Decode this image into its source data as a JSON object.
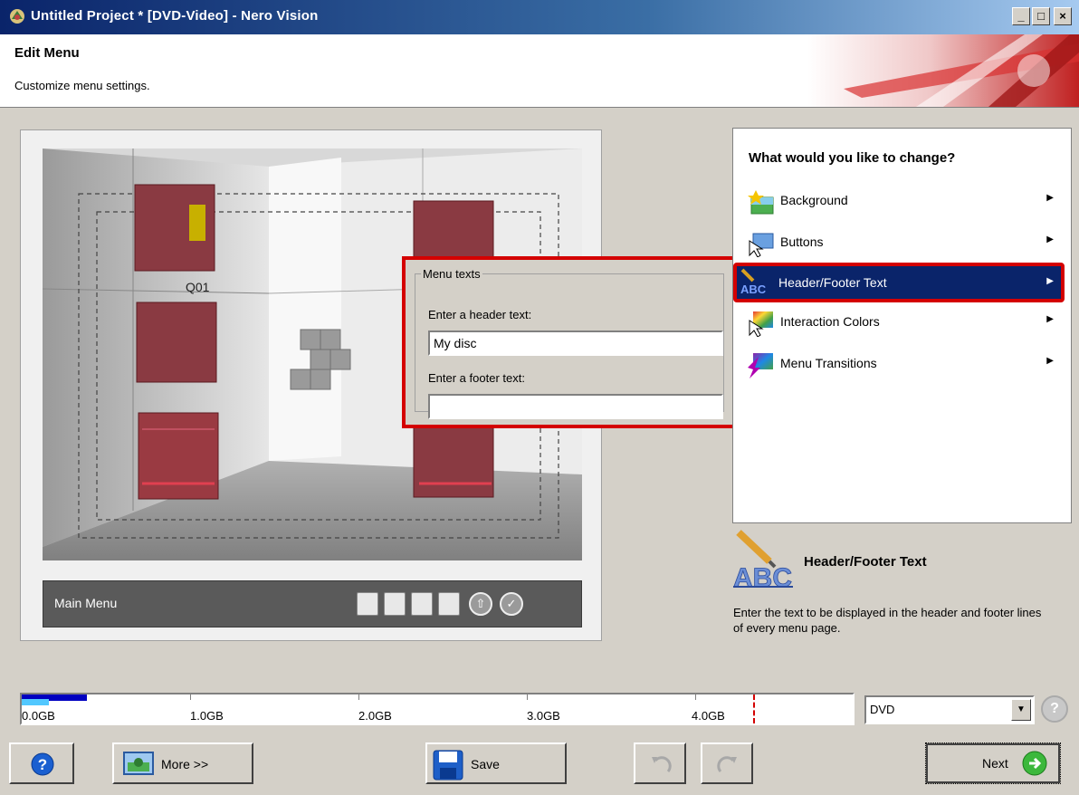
{
  "window": {
    "title": "Untitled Project * [DVD-Video] - Nero Vision",
    "minimize": "_",
    "maximize": "□",
    "close": "×"
  },
  "header": {
    "title": "Edit Menu",
    "subtitle": "Customize menu settings."
  },
  "preview": {
    "button_label": "Q01",
    "bar_label": "Main Menu"
  },
  "menu_texts": {
    "group_title": "Menu texts",
    "header_label": "Enter a header text:",
    "header_value": "My disc",
    "footer_label": "Enter a footer text:",
    "footer_value": ""
  },
  "options": {
    "question": "What would you like to change?",
    "items": [
      {
        "label": "Background",
        "icon": "background-icon"
      },
      {
        "label": "Buttons",
        "icon": "buttons-icon"
      },
      {
        "label": "Header/Footer Text",
        "icon": "abc-text-icon",
        "selected": true
      },
      {
        "label": "Interaction Colors",
        "icon": "interaction-colors-icon"
      },
      {
        "label": "Menu Transitions",
        "icon": "menu-transitions-icon"
      }
    ],
    "arrow": "▶"
  },
  "description": {
    "title": "Header/Footer Text",
    "text": "Enter the text to be displayed in the header and footer lines of every menu page."
  },
  "capacity": {
    "labels": [
      "0.0GB",
      "1.0GB",
      "2.0GB",
      "3.0GB",
      "4.0GB"
    ],
    "disc_type": "DVD",
    "help": "?",
    "used_gb": 0.3
  },
  "bottom": {
    "help": "?",
    "more": "More >>",
    "save": "Save",
    "next": "Next"
  },
  "colors": {
    "selection": "#0a246a",
    "highlight_border": "#d40000",
    "capacity_fill": "#0000c0"
  }
}
